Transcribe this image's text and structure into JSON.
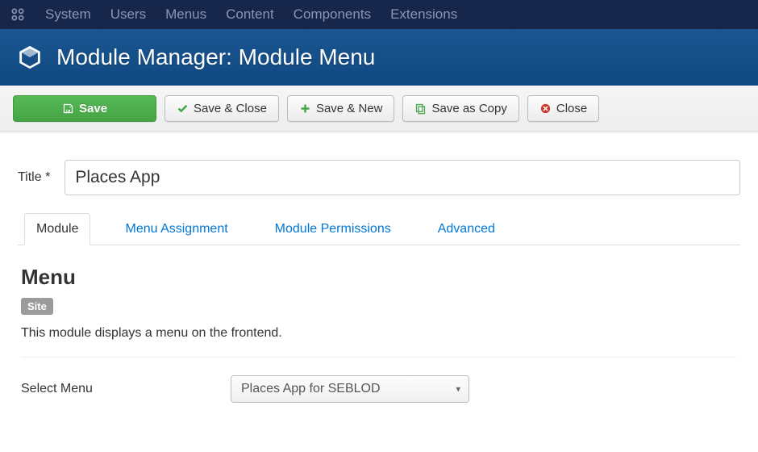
{
  "topnav": {
    "items": [
      "System",
      "Users",
      "Menus",
      "Content",
      "Components",
      "Extensions"
    ]
  },
  "header": {
    "title": "Module Manager: Module Menu"
  },
  "toolbar": {
    "save": "Save",
    "save_close": "Save & Close",
    "save_new": "Save & New",
    "save_copy": "Save as Copy",
    "close": "Close"
  },
  "title_field": {
    "label": "Title *",
    "value": "Places App"
  },
  "tabs": [
    "Module",
    "Menu Assignment",
    "Module Permissions",
    "Advanced"
  ],
  "active_tab": 0,
  "module_panel": {
    "heading": "Menu",
    "badge": "Site",
    "description": "This module displays a menu on the frontend.",
    "select_menu": {
      "label": "Select Menu",
      "value": "Places App for SEBLOD"
    }
  }
}
